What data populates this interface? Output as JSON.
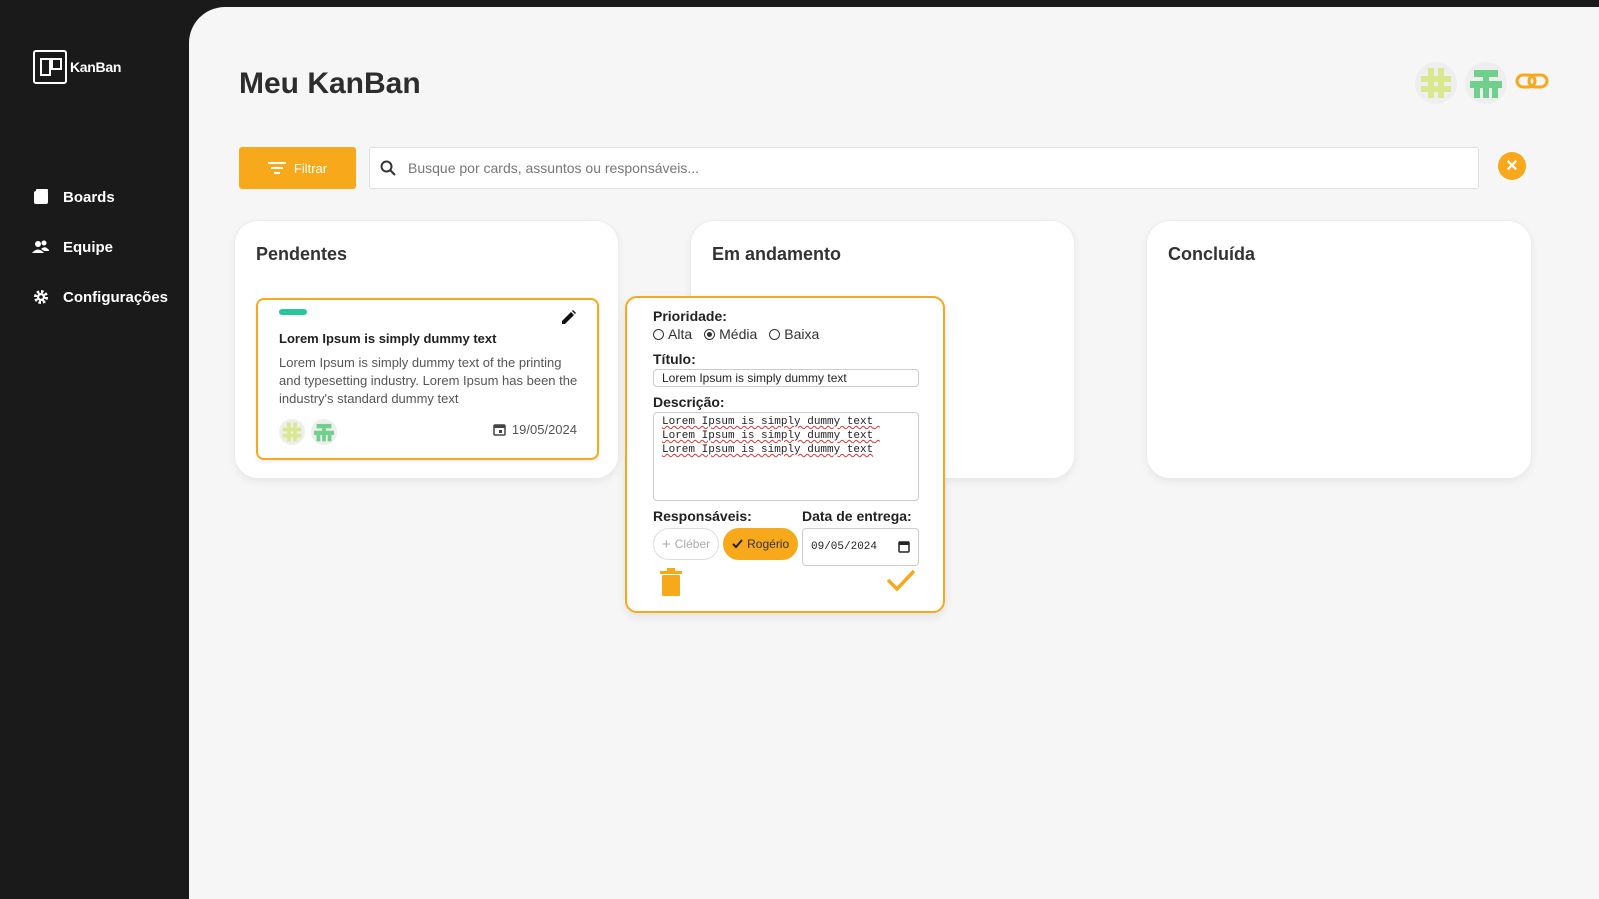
{
  "app": {
    "logo_text": "KanBan",
    "accent_color": "#f8a81b"
  },
  "sidebar": {
    "items": [
      {
        "label": "Boards",
        "icon": "board-icon"
      },
      {
        "label": "Equipe",
        "icon": "team-icon"
      },
      {
        "label": "Configurações",
        "icon": "gear-icon"
      }
    ]
  },
  "header": {
    "title": "Meu KanBan"
  },
  "toolbar": {
    "filter_label": "Filtrar",
    "search_placeholder": "Busque por cards, assuntos ou responsáveis...",
    "search_value": ""
  },
  "columns": [
    {
      "title": "Pendentes"
    },
    {
      "title": "Em andamento"
    },
    {
      "title": "Concluída"
    }
  ],
  "card": {
    "priority_color": "#28c79a",
    "title": "Lorem Ipsum is simply dummy text",
    "description": "Lorem Ipsum is simply dummy text of the printing and typesetting industry. Lorem Ipsum has been the industry's standard dummy text",
    "date": "19/05/2024"
  },
  "editor": {
    "priority_label": "Prioridade:",
    "priority_options": [
      "Alta",
      "Média",
      "Baixa"
    ],
    "priority_selected": "Média",
    "title_label": "Título:",
    "title_value": "Lorem Ipsum is simply dummy text",
    "description_label": "Descrição:",
    "description_value": "Lorem Ipsum is simply dummy text Lorem Ipsum is simply dummy text Lorem Ipsum is simply dummy text",
    "assignees_label": "Responsáveis:",
    "assignees": [
      {
        "name": "Cléber",
        "selected": false
      },
      {
        "name": "Rogério",
        "selected": true
      }
    ],
    "due_label": "Data de entrega:",
    "due_value": "09/05/2024"
  }
}
